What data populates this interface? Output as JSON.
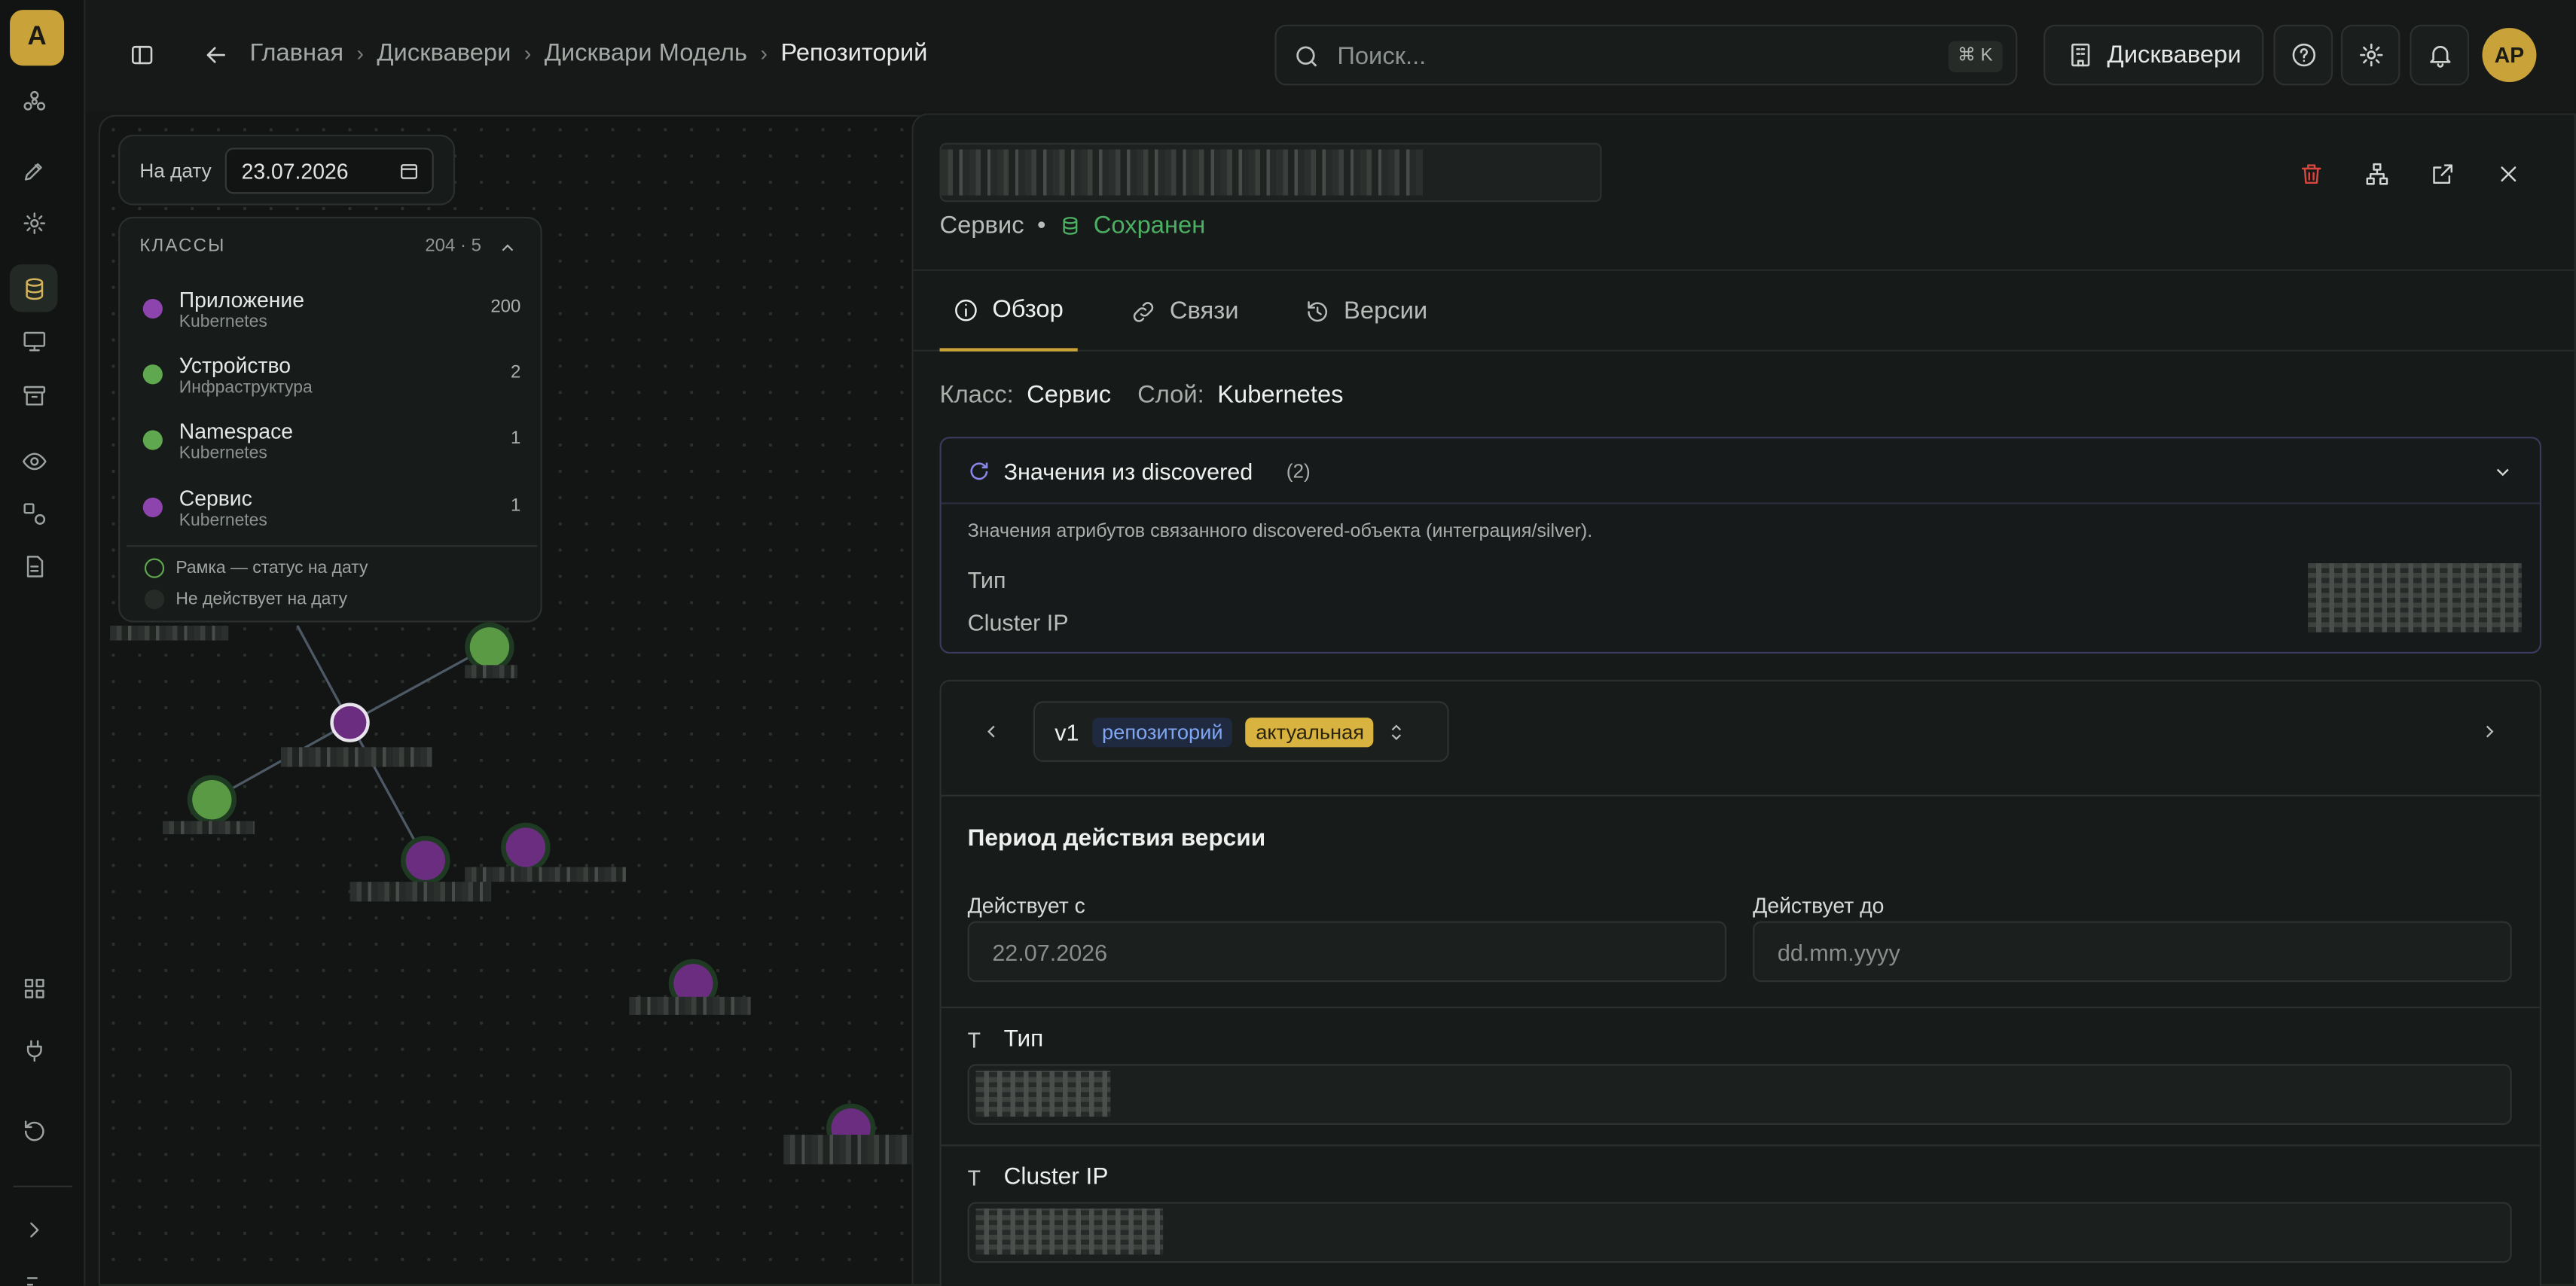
{
  "brand": {
    "logo_letter": "A",
    "accent": "#c9a33a"
  },
  "breadcrumbs": [
    "Главная",
    "Дисквавери",
    "Дисквари Модель",
    "Репозиторий"
  ],
  "search": {
    "placeholder": "Поиск...",
    "shortcut": "⌘ K"
  },
  "header": {
    "workspace_button": "Дисквавери",
    "avatar_initials": "AP"
  },
  "canvas": {
    "date_label": "На дату",
    "date_value": "23.07.2026",
    "classes_header": "КЛАССЫ",
    "classes_count": "204 · 5",
    "classes": [
      {
        "name": "Приложение",
        "sub": "Kubernetes",
        "count": "200",
        "color": "#8e44ad"
      },
      {
        "name": "Устройство",
        "sub": "Инфраструктура",
        "count": "2",
        "color": "#5fa84f"
      },
      {
        "name": "Namespace",
        "sub": "Kubernetes",
        "count": "1",
        "color": "#5fa84f"
      },
      {
        "name": "Сервис",
        "sub": "Kubernetes",
        "count": "1",
        "color": "#8e44ad"
      }
    ],
    "legend": [
      "Рамка — статус на дату",
      "Не действует на дату"
    ]
  },
  "panel": {
    "subtitle_class": "Сервис",
    "status": "Сохранен",
    "status_color": "#4caf63",
    "tabs": [
      "Обзор",
      "Связи",
      "Версии"
    ],
    "class_label": "Класс:",
    "class_value": "Сервис",
    "layer_label": "Слой:",
    "layer_value": "Kubernetes",
    "discovered": {
      "title": "Значения из discovered",
      "count": "(2)",
      "description": "Значения атрибутов связанного discovered-объекта (интеграция/silver).",
      "attrs": [
        "Тип",
        "Cluster IP"
      ]
    },
    "version": {
      "label": "v1",
      "badge_repo": "репозиторий",
      "badge_current": "актуальная",
      "period_title": "Период действия версии",
      "from_label": "Действует с",
      "from_value": "22.07.2026",
      "to_label": "Действует до",
      "to_placeholder": "dd.mm.yyyy"
    },
    "fields": [
      {
        "label": "Тип"
      },
      {
        "label": "Cluster IP"
      }
    ]
  }
}
